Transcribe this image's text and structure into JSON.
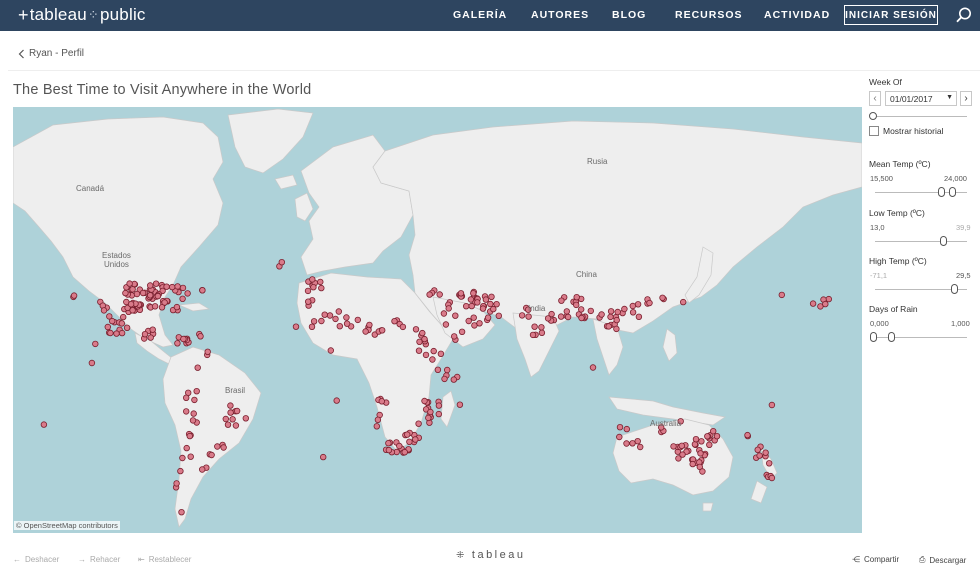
{
  "brand": {
    "part1": "tableau",
    "part2": "public"
  },
  "nav": {
    "items": [
      {
        "label": "GALERÍA"
      },
      {
        "label": "AUTORES"
      },
      {
        "label": "BLOG"
      },
      {
        "label": "RECURSOS"
      },
      {
        "label": "ACTIVIDAD"
      }
    ],
    "signin": "INICIAR SESIÓN",
    "search_icon": "search-icon"
  },
  "breadcrumb": {
    "label": "Ryan - Perfil",
    "icon": "chevron-left-icon"
  },
  "viz": {
    "title": "The Best Time to Visit Anywhere in the World",
    "map_credit": "© OpenStreetMap contributors",
    "map_labels": {
      "canada": "Canadá",
      "usa": "Estados\nUnidos",
      "russia": "Rusia",
      "china": "China",
      "india": "India",
      "brazil": "Brasil",
      "australia": "Australia"
    },
    "colors": {
      "water": "#aed2d9",
      "land": "#eeeeee",
      "border": "#c9c9c9",
      "marker_fill": "#d97b8a",
      "marker_stroke": "#7a1f2e"
    }
  },
  "filters": {
    "week": {
      "title": "Week Of",
      "value": "01/01/2017",
      "prev_icon": "chevron-left-icon",
      "next_icon": "chevron-right-icon"
    },
    "history": {
      "label": "Mostrar historial",
      "checked": false
    },
    "mean_temp": {
      "title": "Mean Temp (ºC)",
      "min": "15,500",
      "max": "24,000"
    },
    "low_temp": {
      "title": "Low Temp (ºC)",
      "min": "13,0",
      "max": "39,9"
    },
    "high_temp": {
      "title": "High Temp (ºC)",
      "min": "-71,1",
      "max": "29,5"
    },
    "rain": {
      "title": "Days of Rain",
      "min": "0,000",
      "max": "1,000"
    }
  },
  "toolbar": {
    "undo": "Deshacer",
    "redo": "Rehacer",
    "reset": "Restablecer",
    "center_logo": "tableau",
    "share": "Compartir",
    "download": "Descargar"
  }
}
